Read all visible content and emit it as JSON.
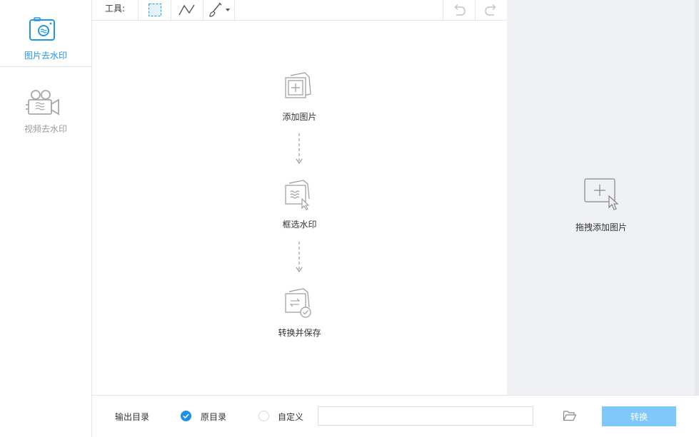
{
  "sidebar": {
    "items": [
      {
        "label": "图片去水印",
        "icon": "photo-camera-icon",
        "active": true
      },
      {
        "label": "视频去水印",
        "icon": "video-camera-icon",
        "active": false
      }
    ]
  },
  "toolbar": {
    "label": "工具:",
    "tools": [
      {
        "name": "rect-select",
        "icon": "dashed-rect-select-icon"
      },
      {
        "name": "polyline",
        "icon": "polyline-icon"
      },
      {
        "name": "brush",
        "icon": "brush-icon"
      }
    ],
    "undo_icon": "undo-icon",
    "redo_icon": "redo-icon"
  },
  "steps": [
    {
      "label": "添加图片",
      "icon": "add-image-icon"
    },
    {
      "label": "框选水印",
      "icon": "select-watermark-icon"
    },
    {
      "label": "转换并保存",
      "icon": "convert-save-icon"
    }
  ],
  "drop_panel": {
    "label": "拖拽添加图片",
    "icon": "add-cursor-icon"
  },
  "output": {
    "label": "输出目录",
    "option_original": "原目录",
    "option_custom": "自定义",
    "selected": "原目录",
    "path_value": "",
    "convert_label": "转换"
  },
  "colors": {
    "accent": "#2196e8",
    "convert_button": "#7ec8fa",
    "drop_panel_bg": "#f0f1f4"
  }
}
